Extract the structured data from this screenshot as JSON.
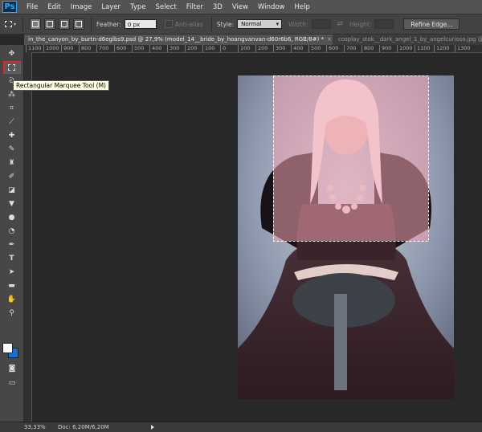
{
  "app": {
    "logo": "Ps"
  },
  "menu": [
    "File",
    "Edit",
    "Image",
    "Layer",
    "Type",
    "Select",
    "Filter",
    "3D",
    "View",
    "Window",
    "Help"
  ],
  "options": {
    "feather_label": "Feather:",
    "feather_value": "0 px",
    "antialias_label": "Anti-alias",
    "style_label": "Style:",
    "style_value": "Normal",
    "width_label": "Width:",
    "height_label": "Height:",
    "refine_label": "Refine Edge..."
  },
  "tabs": [
    {
      "label": "in_the_canyon_by_burtn-d6eglbs9.psd @ 27,9% (model_14__bride_by_hoangvanvan-d60r6b6, RGB/8#) *",
      "close": "×"
    },
    {
      "label": "cosplay_stok__dark_angel_1_by_angelcurioso.jpg @",
      "close": ""
    }
  ],
  "ruler": [
    "1100",
    "1000",
    "900",
    "800",
    "700",
    "600",
    "500",
    "400",
    "300",
    "200",
    "100",
    "0",
    "100",
    "200",
    "300",
    "400",
    "500",
    "600",
    "700",
    "800",
    "900",
    "1000",
    "1100",
    "1200",
    "1300"
  ],
  "tooltip": "Rectangular Marquee Tool (M)",
  "status": {
    "zoom": "33,33%",
    "doc": "Doc: 6,20M/6,20M"
  },
  "colors": {
    "foreground": "#ffffff",
    "background": "#1a6fd0",
    "selection_overlay": "#f2a3b0"
  }
}
